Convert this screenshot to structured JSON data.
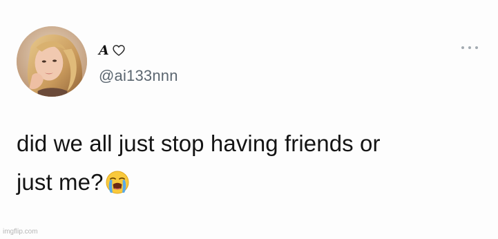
{
  "profile": {
    "display_name": "A",
    "handle": "@ai133nnn",
    "avatar_icon": "profile-photo",
    "name_emoji_icon": "white-heart-icon"
  },
  "tweet": {
    "line1": "did we all just stop having friends or",
    "line2": "just me?",
    "trailing_emoji_icon": "loudly-crying-face-icon"
  },
  "more_icon": "ellipsis-icon",
  "watermark": "imgflip.com",
  "colors": {
    "handle_gray": "#5b6670",
    "text": "#141414",
    "ellipsis": "#a3aab1"
  }
}
